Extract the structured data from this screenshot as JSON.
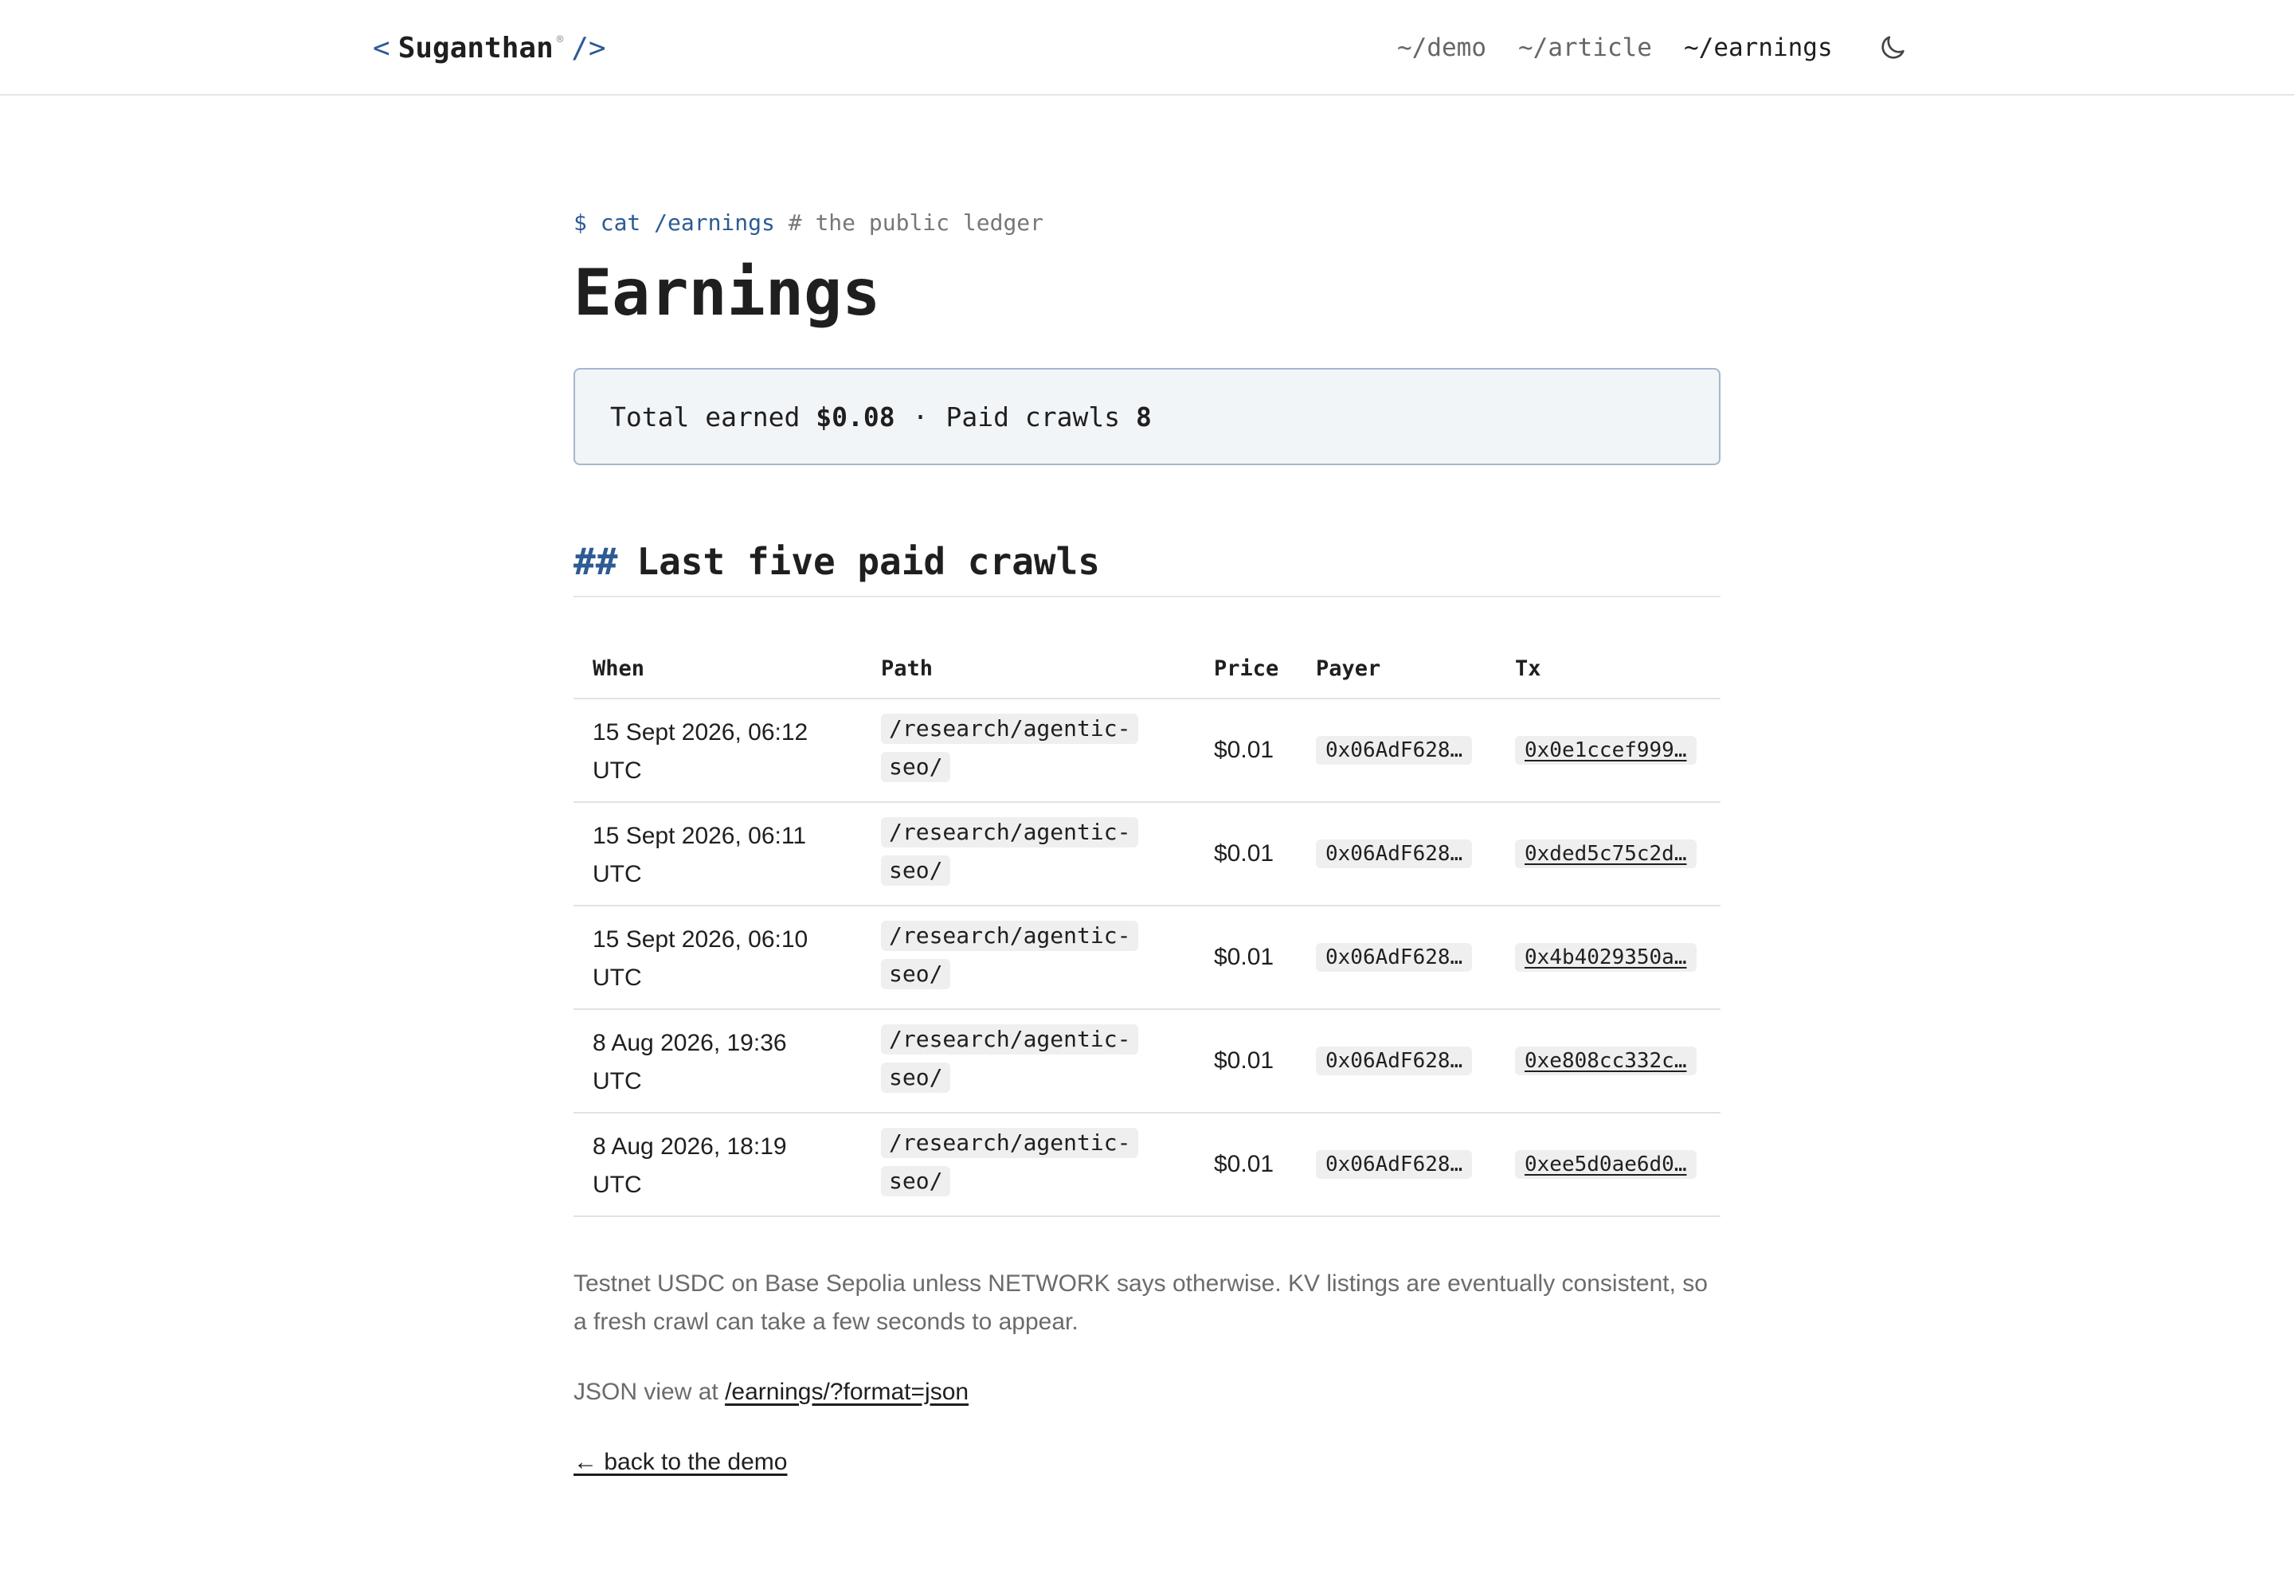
{
  "header": {
    "logo": {
      "open": "<",
      "name": "Suganthan",
      "mark": "®",
      "close": "/>"
    },
    "nav": [
      {
        "label": "~/demo",
        "active": false
      },
      {
        "label": "~/article",
        "active": false
      },
      {
        "label": "~/earnings",
        "active": true
      }
    ],
    "theme_icon": "moon-icon"
  },
  "prompt": {
    "command": "$ cat /earnings",
    "comment": "# the public ledger"
  },
  "title": "Earnings",
  "summary": {
    "total_label": "Total earned",
    "total_value": "$0.08",
    "separator": "·",
    "crawls_label": "Paid crawls",
    "crawls_value": "8"
  },
  "section": {
    "hash": "##",
    "title": "Last five paid crawls"
  },
  "table": {
    "headers": [
      "When",
      "Path",
      "Price",
      "Payer",
      "Tx"
    ],
    "rows": [
      {
        "when1": "15 Sept 2026, 06:12",
        "when2": "UTC",
        "path1": "/research/agentic-",
        "path2": "seo/",
        "price": "$0.01",
        "payer": "0x06AdF628…",
        "tx": "0x0e1ccef999…"
      },
      {
        "when1": "15 Sept 2026, 06:11",
        "when2": "UTC",
        "path1": "/research/agentic-",
        "path2": "seo/",
        "price": "$0.01",
        "payer": "0x06AdF628…",
        "tx": "0xded5c75c2d…"
      },
      {
        "when1": "15 Sept 2026, 06:10",
        "when2": "UTC",
        "path1": "/research/agentic-",
        "path2": "seo/",
        "price": "$0.01",
        "payer": "0x06AdF628…",
        "tx": "0x4b4029350a…"
      },
      {
        "when1": "8 Aug 2026, 19:36",
        "when2": "UTC",
        "path1": "/research/agentic-",
        "path2": "seo/",
        "price": "$0.01",
        "payer": "0x06AdF628…",
        "tx": "0xe808cc332c…"
      },
      {
        "when1": "8 Aug 2026, 18:19",
        "when2": "UTC",
        "path1": "/research/agentic-",
        "path2": "seo/",
        "price": "$0.01",
        "payer": "0x06AdF628…",
        "tx": "0xee5d0ae6d0…"
      }
    ]
  },
  "footer": {
    "note": "Testnet USDC on Base Sepolia unless NETWORK says otherwise. KV listings are eventually consistent, so a fresh crawl can take a few seconds to appear.",
    "json_prefix": "JSON view at",
    "json_link": "/earnings/?format=json",
    "back_link": "← back to the demo"
  },
  "colors": {
    "accent": "#2d5b94",
    "summary_bg": "#f2f5f8",
    "summary_border": "#a3b8cf"
  }
}
